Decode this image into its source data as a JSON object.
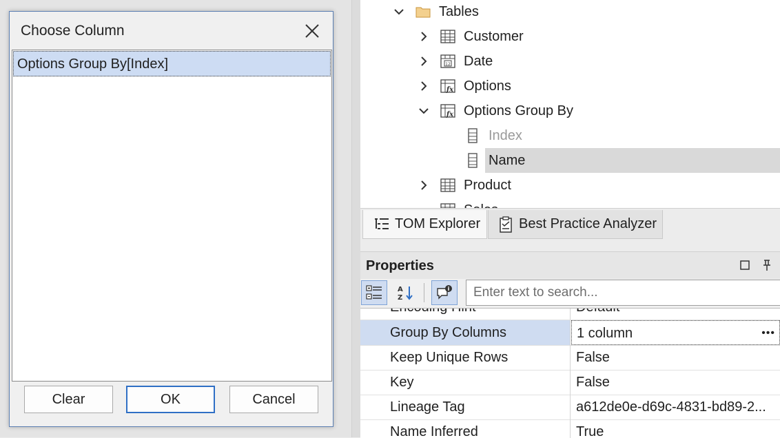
{
  "dialog": {
    "title": "Choose Column",
    "items": [
      "Options Group By[Index]"
    ],
    "buttons": {
      "clear": "Clear",
      "ok": "OK",
      "cancel": "Cancel"
    }
  },
  "tree": {
    "tables_label": "Tables",
    "nodes": [
      {
        "label": "Customer",
        "icon": "table-icon"
      },
      {
        "label": "Date",
        "icon": "calendar-table-icon"
      },
      {
        "label": "Options",
        "icon": "calculated-table-icon"
      },
      {
        "label": "Options Group By",
        "icon": "calculated-table-icon"
      },
      {
        "label": "Index",
        "icon": "column-icon"
      },
      {
        "label": "Name",
        "icon": "column-icon"
      },
      {
        "label": "Product",
        "icon": "table-icon"
      },
      {
        "label": "Sales",
        "icon": "table-icon"
      }
    ]
  },
  "tabs": {
    "tom_explorer": "TOM Explorer",
    "bpa": "Best Practice Analyzer"
  },
  "properties": {
    "title": "Properties",
    "search_placeholder": "Enter text to search...",
    "rows": [
      {
        "name": "Encoding Hint",
        "value": "Default"
      },
      {
        "name": "Group By Columns",
        "value": "1 column"
      },
      {
        "name": "Keep Unique Rows",
        "value": "False"
      },
      {
        "name": "Key",
        "value": "False"
      },
      {
        "name": "Lineage Tag",
        "value": "a612de0e-d69c-4831-bd89-2..."
      },
      {
        "name": "Name Inferred",
        "value": "True"
      }
    ]
  },
  "colors": {
    "selection": "#cddcf3",
    "accent": "#2f6fc5",
    "folder": "#e8c07a"
  }
}
